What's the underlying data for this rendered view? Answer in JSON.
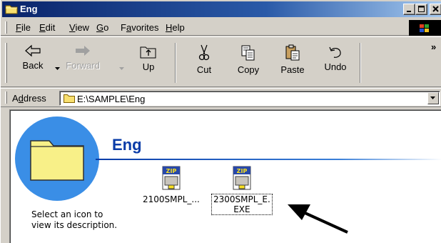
{
  "window": {
    "title": "Eng",
    "icons": {
      "app": "folder-icon",
      "minimize": "minimize-icon",
      "maximize": "maximize-icon",
      "close": "close-icon"
    }
  },
  "menubar": {
    "items": [
      {
        "label": "File",
        "accel": "F"
      },
      {
        "label": "Edit",
        "accel": "E"
      },
      {
        "label": "View",
        "accel": "V"
      },
      {
        "label": "Go",
        "accel": "G"
      },
      {
        "label": "Favorites",
        "accel": "a"
      },
      {
        "label": "Help",
        "accel": "H"
      }
    ],
    "brand_icon": "windows-logo-icon"
  },
  "toolbar": {
    "buttons": [
      {
        "label": "Back",
        "icon": "back-arrow-icon",
        "enabled": true,
        "dropdown": true
      },
      {
        "label": "Forward",
        "icon": "forward-arrow-icon",
        "enabled": false,
        "dropdown": true
      },
      {
        "label": "Up",
        "icon": "up-folder-icon",
        "enabled": true
      },
      {
        "label": "Cut",
        "icon": "scissors-icon",
        "enabled": true
      },
      {
        "label": "Copy",
        "icon": "copy-icon",
        "enabled": true
      },
      {
        "label": "Paste",
        "icon": "paste-icon",
        "enabled": true
      },
      {
        "label": "Undo",
        "icon": "undo-icon",
        "enabled": true
      }
    ],
    "overflow": "»"
  },
  "address": {
    "label": "Address",
    "accel": "d",
    "value": "E:\\SAMPLE\\Eng"
  },
  "content": {
    "folder_name": "Eng",
    "description": [
      "Select an icon to",
      "view its description."
    ],
    "files": [
      {
        "name": "2100SMPL_...",
        "icon": "zip-archive-icon",
        "selected": false
      },
      {
        "name_lines": [
          "2300SMPL_E.",
          "EXE"
        ],
        "icon": "zip-archive-icon",
        "selected": true
      }
    ],
    "annotation": "arrow-pointer-icon"
  },
  "colors": {
    "titlebar_start": "#0a246a",
    "titlebar_end": "#a6caf0",
    "chrome": "#d4d0c8",
    "folder_title": "#0a3ca8",
    "folder_yellow": "#f8f088"
  }
}
